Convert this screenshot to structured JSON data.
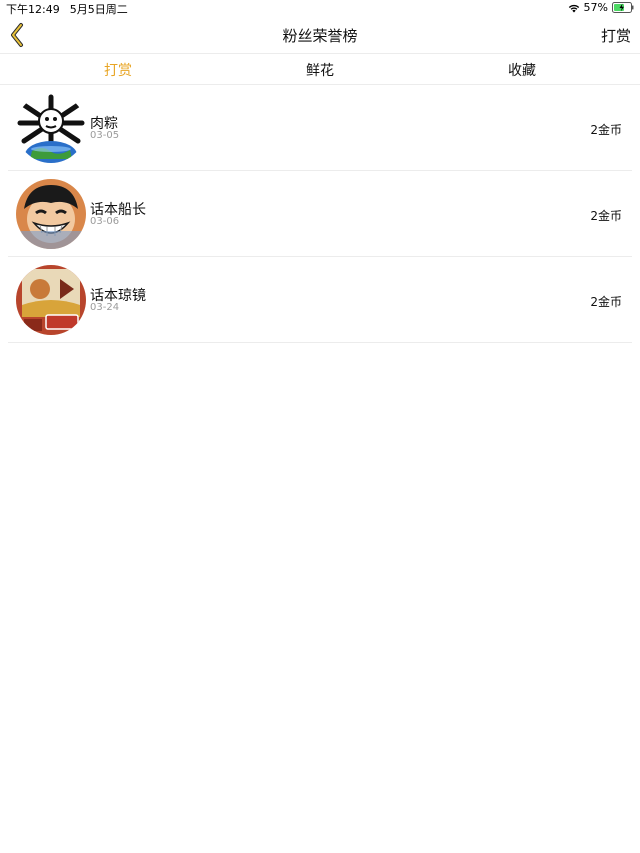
{
  "status_bar": {
    "time": "下午12:49",
    "date": "5月5日周二",
    "battery": "57%"
  },
  "nav": {
    "title": "粉丝荣誉榜",
    "right_action": "打赏"
  },
  "tabs": [
    {
      "label": "打赏",
      "active": true
    },
    {
      "label": "鲜花",
      "active": false
    },
    {
      "label": "收藏",
      "active": false
    }
  ],
  "list": [
    {
      "name": "肉粽",
      "date": "03-05",
      "amount": "2金币",
      "avatar": "pirate-flag-globe-avatar"
    },
    {
      "name": "话本船长",
      "date": "03-06",
      "amount": "2金币",
      "avatar": "straw-hat-boy-avatar"
    },
    {
      "name": "话本琼镜",
      "date": "03-24",
      "amount": "2金币",
      "avatar": "poster-avatar"
    }
  ],
  "colors": {
    "accent": "#e8a524",
    "divider": "#ececec",
    "secondary_text": "#9b9b9b"
  }
}
